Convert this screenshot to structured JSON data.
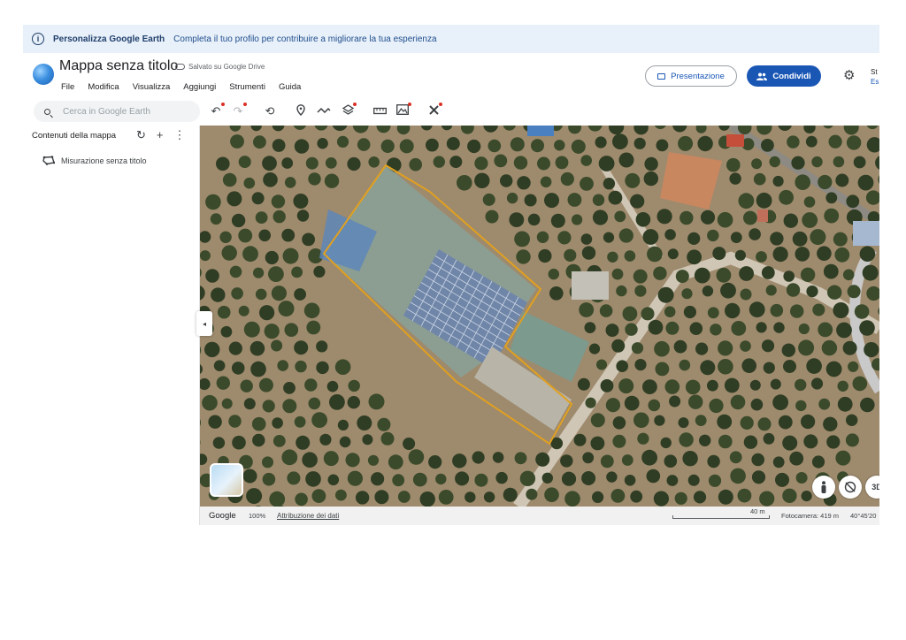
{
  "banner": {
    "title": "Personalizza Google Earth",
    "text": "Completa il tuo profilo per contribuire a migliorare la tua esperienza"
  },
  "header": {
    "doc_title": "Mappa senza titolo",
    "saved_status": "Salvato su Google Drive",
    "menus": [
      "File",
      "Modifica",
      "Visualizza",
      "Aggiungi",
      "Strumenti",
      "Guida"
    ],
    "presentation_label": "Presentazione",
    "share_label": "Condividi",
    "user_line1": "St",
    "user_line2": "Es"
  },
  "toolbar": {
    "search_placeholder": "Cerca in Google Earth",
    "icons": [
      "undo-icon",
      "redo-icon",
      "history-icon",
      "placemark-icon",
      "path-icon",
      "layers-icon",
      "ruler-icon",
      "image-overlay-icon",
      "tools-icon"
    ]
  },
  "sidebar": {
    "heading": "Contenuti della mappa",
    "items": [
      {
        "label": "Misurazione senza titolo",
        "icon": "polygon-measure-icon"
      }
    ]
  },
  "map": {
    "view_mode": "3D",
    "status": {
      "brand": "Google",
      "zoom": "100%",
      "attribution": "Attribuzione dei dati",
      "scale": "40 m",
      "camera": "Fotocamera: 419 m",
      "coordinates": "40°45'20"
    }
  },
  "colors": {
    "accent": "#1a57b5",
    "banner_bg": "#e8f0fa",
    "measurement_outline": "#e0a020",
    "notification_dot": "#d93025"
  }
}
